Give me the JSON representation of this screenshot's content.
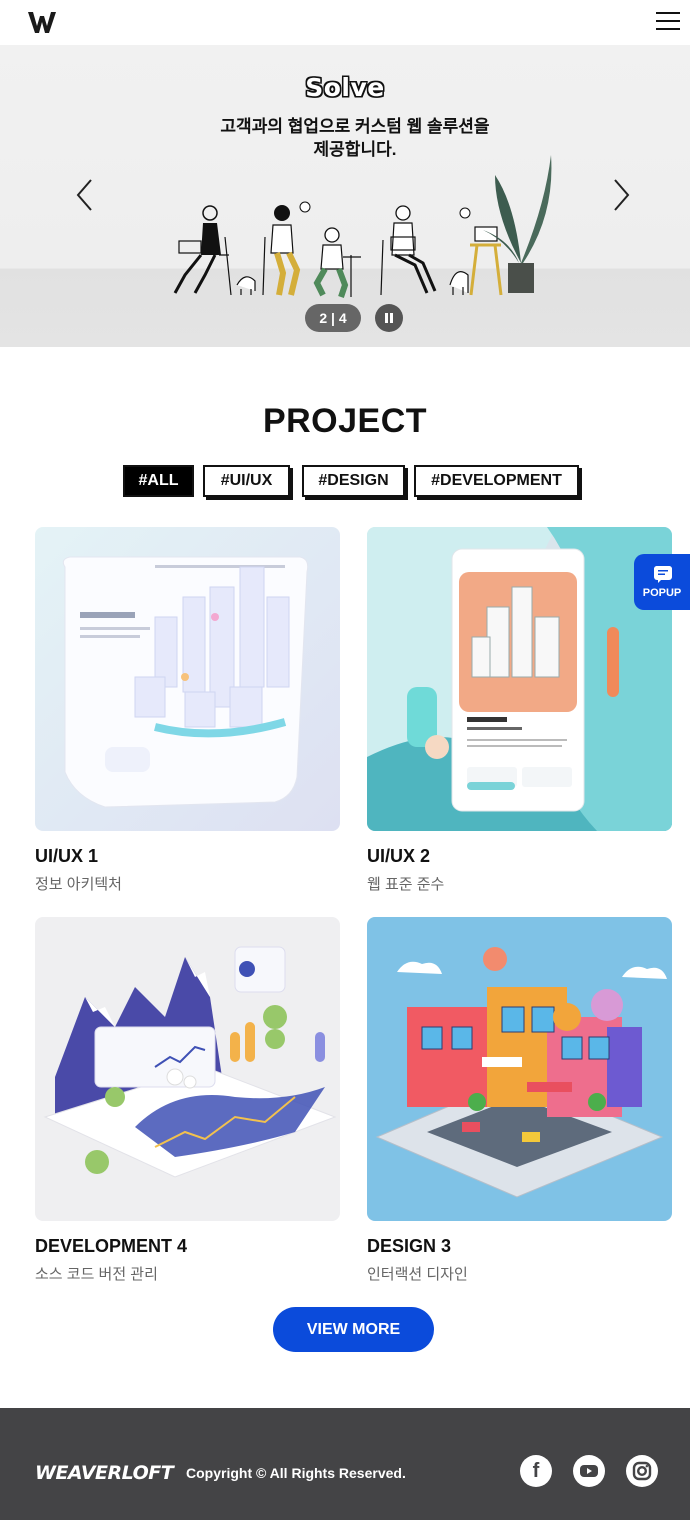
{
  "header": {
    "logo_text": "W",
    "menu_icon": "hamburger-icon"
  },
  "hero": {
    "title": "Solve",
    "subtitle_line1": "고객과의 협업으로 커스텀 웹 솔루션을",
    "subtitle_line2": "제공합니다.",
    "counter": "2 | 4",
    "prev_icon": "chevron-left-icon",
    "next_icon": "chevron-right-icon",
    "pause_icon": "pause-icon"
  },
  "project": {
    "title": "PROJECT",
    "filters": [
      {
        "label": "#ALL",
        "active": true
      },
      {
        "label": "#UI/UX",
        "active": false
      },
      {
        "label": "#DESIGN",
        "active": false
      },
      {
        "label": "#DEVELOPMENT",
        "active": false
      }
    ],
    "cards": [
      {
        "title": "UI/UX 1",
        "subtitle": "정보 아키텍처"
      },
      {
        "title": "UI/UX 2",
        "subtitle": "웹 표준 준수"
      },
      {
        "title": "DEVELOPMENT 4",
        "subtitle": "소스 코드 버전 관리"
      },
      {
        "title": "DESIGN 3",
        "subtitle": "인터랙션 디자인"
      }
    ],
    "view_more": "VIEW MORE"
  },
  "popup": {
    "label": "POPUP",
    "icon": "chat-icon"
  },
  "footer": {
    "logo_text": "WEAVERLOFT",
    "copyright": "Copyright © All Rights Reserved.",
    "social": [
      {
        "name": "facebook",
        "glyph": "f"
      },
      {
        "name": "youtube",
        "glyph": "▶"
      },
      {
        "name": "instagram",
        "glyph": "◎"
      }
    ]
  },
  "colors": {
    "accent": "#0b4bdb",
    "footer_bg": "#444446",
    "dark": "#111111"
  }
}
